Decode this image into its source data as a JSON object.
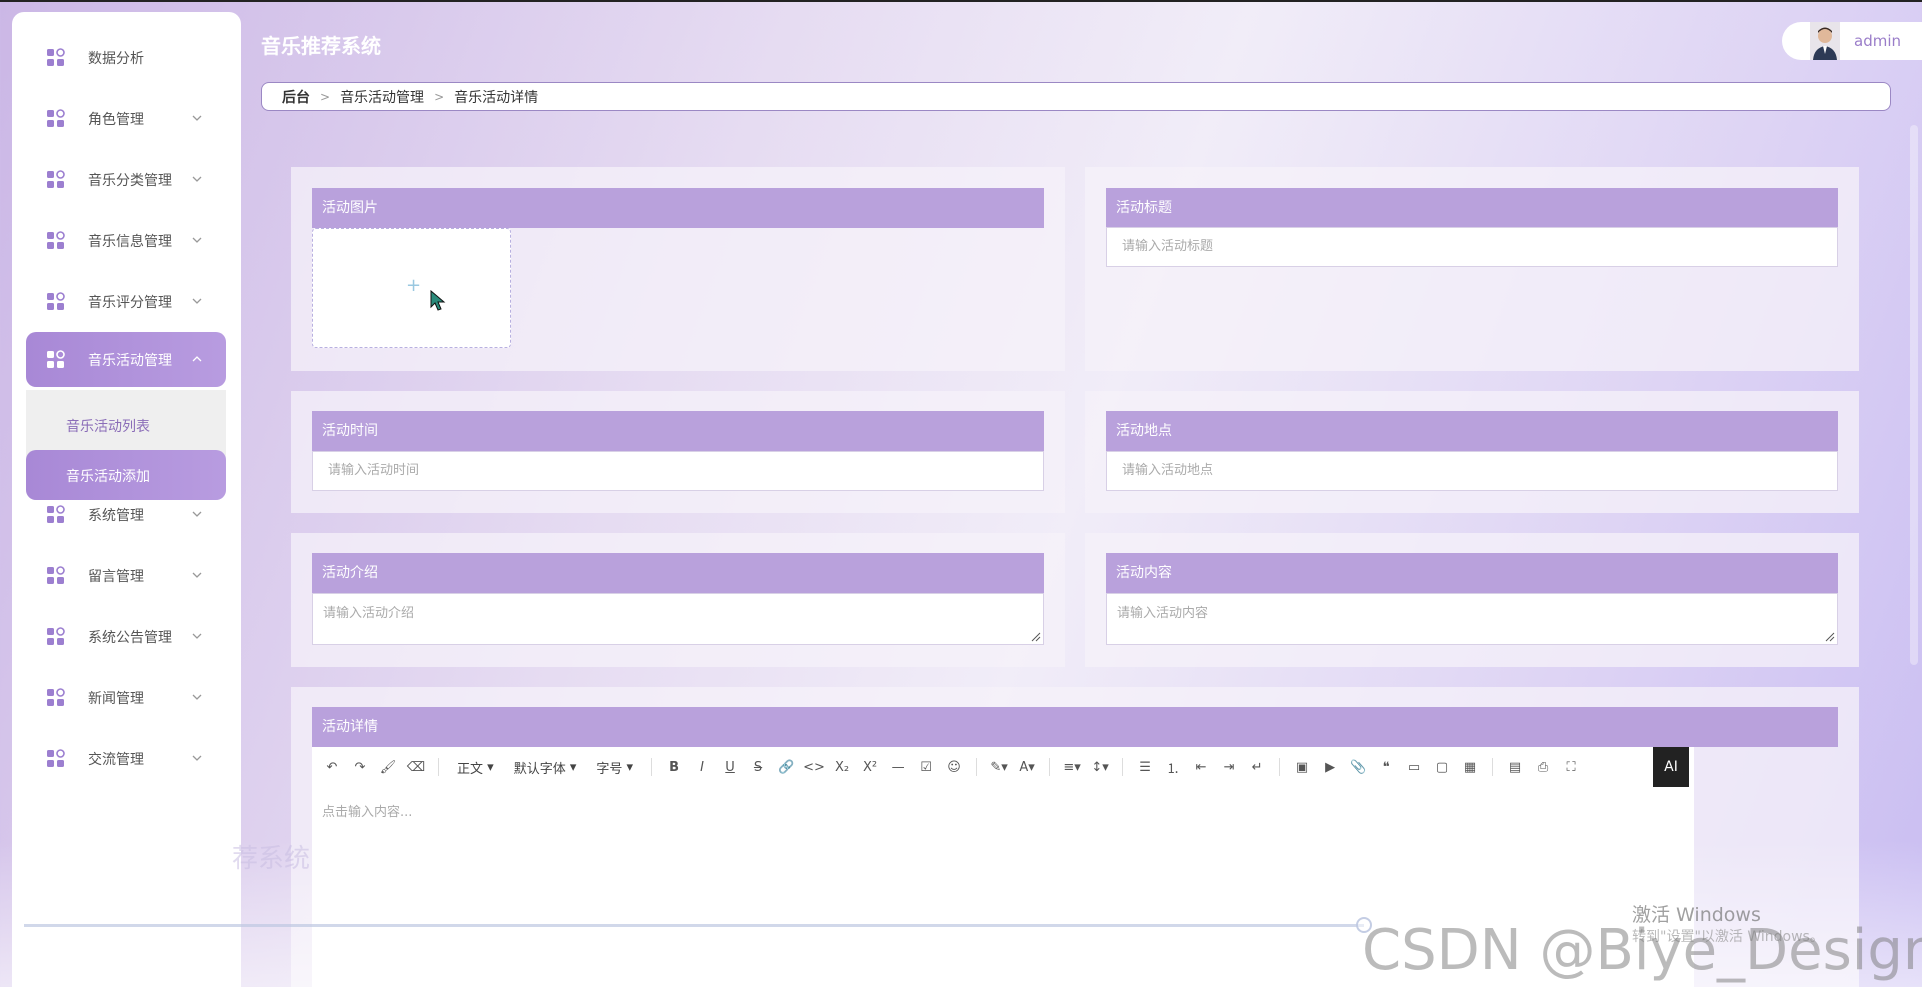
{
  "app": {
    "title": "音乐推荐系统",
    "user": "admin"
  },
  "breadcrumb": [
    "后台",
    "音乐活动管理",
    "音乐活动详情"
  ],
  "sidebar": {
    "items": [
      {
        "label": "数据分析",
        "has_children": false
      },
      {
        "label": "角色管理",
        "has_children": true
      },
      {
        "label": "音乐分类管理",
        "has_children": true
      },
      {
        "label": "音乐信息管理",
        "has_children": true
      },
      {
        "label": "音乐评分管理",
        "has_children": true
      },
      {
        "label": "音乐活动管理",
        "has_children": true,
        "expanded": true,
        "active": true
      },
      {
        "label": "系统管理",
        "has_children": true
      },
      {
        "label": "留言管理",
        "has_children": true
      },
      {
        "label": "系统公告管理",
        "has_children": true
      },
      {
        "label": "新闻管理",
        "has_children": true
      },
      {
        "label": "交流管理",
        "has_children": true
      }
    ],
    "submenu": [
      {
        "label": "音乐活动列表",
        "active": false
      },
      {
        "label": "音乐活动添加",
        "active": true
      }
    ]
  },
  "form": {
    "image": {
      "label": "活动图片",
      "plus": "+"
    },
    "title": {
      "label": "活动标题",
      "placeholder": "请输入活动标题"
    },
    "time": {
      "label": "活动时间",
      "placeholder": "请输入活动时间"
    },
    "location": {
      "label": "活动地点",
      "placeholder": "请输入活动地点"
    },
    "intro": {
      "label": "活动介绍",
      "placeholder": "请输入活动介绍"
    },
    "content": {
      "label": "活动内容",
      "placeholder": "请输入活动内容"
    },
    "detail": {
      "label": "活动详情",
      "placeholder": "点击输入内容..."
    }
  },
  "editor": {
    "paragraph": "正文",
    "font": "默认字体",
    "size": "字号",
    "ai": "AI"
  },
  "watermarks": {
    "ghost": "荐系统",
    "windows_line1": "激活 Windows",
    "windows_line2": "转到\"设置\"以激活 Windows。",
    "csdn": "CSDN @Biye_Design"
  },
  "colors": {
    "accent": "#b9a1dc",
    "active_menu": "#a888d6",
    "sub_text": "#8b6db8"
  }
}
